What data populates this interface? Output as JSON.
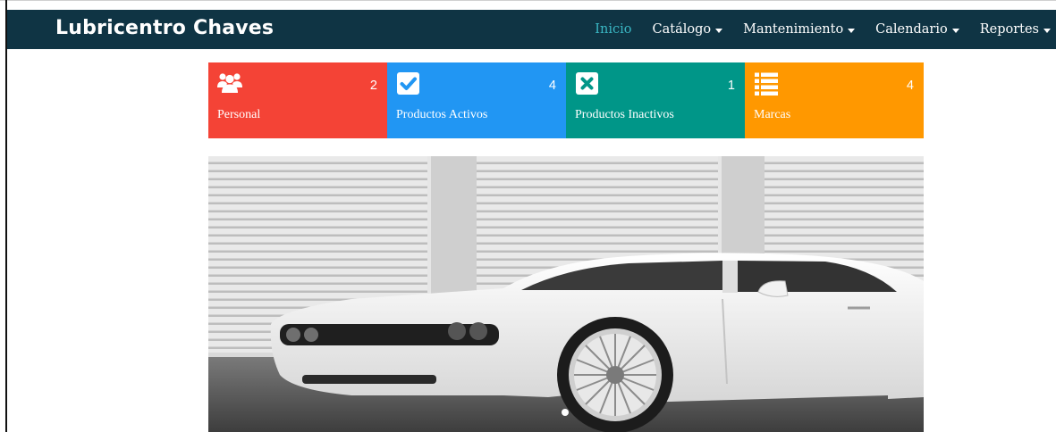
{
  "brand": "Lubricentro Chaves",
  "nav": [
    {
      "label": "Inicio",
      "active": true,
      "dropdown": false
    },
    {
      "label": "Catálogo",
      "active": false,
      "dropdown": true
    },
    {
      "label": "Mantenimiento",
      "active": false,
      "dropdown": true
    },
    {
      "label": "Calendario",
      "active": false,
      "dropdown": true
    },
    {
      "label": "Reportes",
      "active": false,
      "dropdown": true
    }
  ],
  "cards": [
    {
      "label": "Personal",
      "count": "2",
      "color": "#f44336",
      "icon": "users-icon"
    },
    {
      "label": "Productos Activos",
      "count": "4",
      "color": "#2196f3",
      "icon": "check-square-icon"
    },
    {
      "label": "Productos Inactivos",
      "count": "1",
      "color": "#009688",
      "icon": "x-square-icon"
    },
    {
      "label": "Marcas",
      "count": "4",
      "color": "#ff9800",
      "icon": "list-icon"
    }
  ],
  "carousel": {
    "image": "white car in front of garage shutters",
    "slide_count": 1,
    "active_index": 0
  }
}
